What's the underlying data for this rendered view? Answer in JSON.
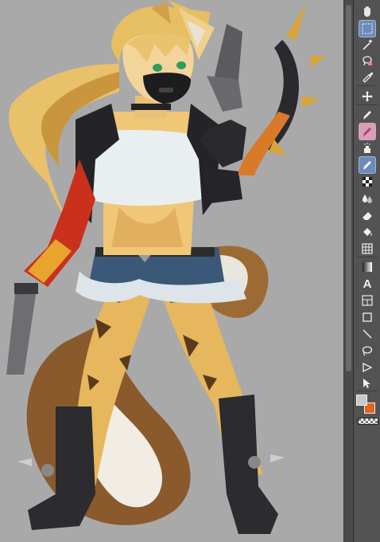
{
  "toolbar": {
    "tools": [
      {
        "name": "hand-tool",
        "icon": "hand-icon"
      },
      {
        "name": "select-layer-tool",
        "icon": "select-layer-icon"
      },
      {
        "name": "auto-select-tool",
        "icon": "magic-wand-icon"
      },
      {
        "name": "lasso-fill-tool",
        "icon": "lasso-fill-icon"
      },
      {
        "name": "eyedropper-tool",
        "icon": "eyedropper-icon"
      },
      {
        "name": "move-tool",
        "icon": "move-icon"
      },
      {
        "name": "pen-tool",
        "icon": "pen-icon"
      },
      {
        "name": "pencil-tool",
        "icon": "pencil-icon"
      },
      {
        "name": "airbrush-tool",
        "icon": "airbrush-icon"
      },
      {
        "name": "brush-tool",
        "icon": "brush-icon"
      },
      {
        "name": "pattern-tool",
        "icon": "checker-icon"
      },
      {
        "name": "blend-tool",
        "icon": "drops-icon"
      },
      {
        "name": "eraser-tool",
        "icon": "eraser-icon"
      },
      {
        "name": "fill-tool",
        "icon": "bucket-icon"
      },
      {
        "name": "grid-tool",
        "icon": "grid-icon"
      },
      {
        "name": "gradient-tool",
        "icon": "gradient-icon"
      },
      {
        "name": "text-tool",
        "icon": "text-icon"
      },
      {
        "name": "frame-tool",
        "icon": "frame-icon"
      },
      {
        "name": "rectangle-tool",
        "icon": "rectangle-icon"
      },
      {
        "name": "line-tool",
        "icon": "line-icon"
      },
      {
        "name": "ellipse-tool",
        "icon": "lasso-icon"
      },
      {
        "name": "ruler-tool",
        "icon": "ruler-icon"
      },
      {
        "name": "object-select-tool",
        "icon": "arrow-icon"
      }
    ],
    "text_tool_glyph": "A",
    "colors": {
      "foreground": "#c8c8c8",
      "background": "#e2641f",
      "active_tool_bg": "#6e8ab8"
    }
  }
}
